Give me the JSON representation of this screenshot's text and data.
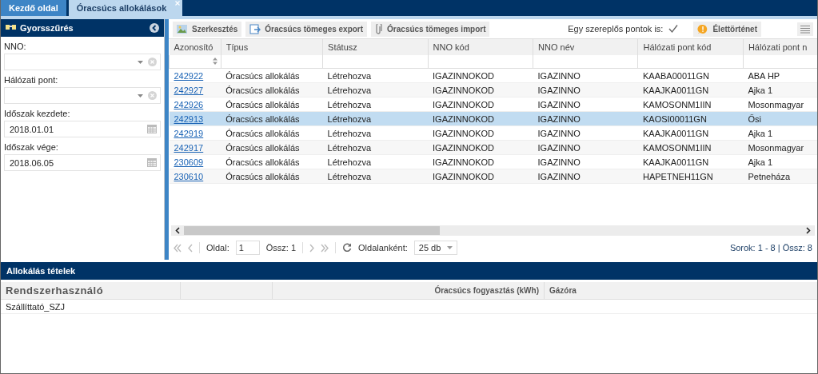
{
  "tabs": [
    {
      "label": "Kezdő oldal",
      "selected": false
    },
    {
      "label": "Óracsúcs allokálások",
      "selected": true,
      "closable": true
    }
  ],
  "filter": {
    "title": "Gyorsszűrés",
    "fields": [
      {
        "label": "NNO:",
        "kind": "combo"
      },
      {
        "label": "Hálózati pont:",
        "kind": "combo"
      },
      {
        "label": "Időszak kezdete:",
        "kind": "date",
        "value": "2018.01.01"
      },
      {
        "label": "Időszak vége:",
        "kind": "date",
        "value": "2018.06.05"
      }
    ]
  },
  "toolbar": {
    "buttons": [
      {
        "label": "Szerkesztés",
        "kind": "edit"
      },
      {
        "label": "Óracsúcs tömeges export",
        "kind": "export"
      },
      {
        "label": "Óracsúcs tömeges import",
        "kind": "import"
      }
    ],
    "checkbox": {
      "label": "Egy szereplős pontok is:",
      "checked": true
    },
    "history": "Élettörténet"
  },
  "table": {
    "columns": [
      "Azonosító",
      "Típus",
      "Státusz",
      "NNO kód",
      "NNO név",
      "Hálózati pont kód",
      "Hálózati pont n"
    ],
    "rows": [
      {
        "selected": false,
        "cells": [
          "242922",
          "Óracsúcs allokálás",
          "Létrehozva",
          "IGAZINNOKOD",
          "IGAZINNO",
          "KAABA00011GN",
          "ABA HP"
        ]
      },
      {
        "selected": false,
        "cells": [
          "242927",
          "Óracsúcs allokálás",
          "Létrehozva",
          "IGAZINNOKOD",
          "IGAZINNO",
          "KAAJKA0011GN",
          "Ajka 1"
        ]
      },
      {
        "selected": false,
        "cells": [
          "242926",
          "Óracsúcs allokálás",
          "Létrehozva",
          "IGAZINNOKOD",
          "IGAZINNO",
          "KAMOSONM1IIN",
          "Mosonmagyar"
        ]
      },
      {
        "selected": true,
        "cells": [
          "242913",
          "Óracsúcs allokálás",
          "Létrehozva",
          "IGAZINNOKOD",
          "IGAZINNO",
          "KAOSI00011GN",
          "Ősi"
        ]
      },
      {
        "selected": false,
        "cells": [
          "242919",
          "Óracsúcs allokálás",
          "Létrehozva",
          "IGAZINNOKOD",
          "IGAZINNO",
          "KAAJKA0011GN",
          "Ajka 1"
        ]
      },
      {
        "selected": false,
        "cells": [
          "242917",
          "Óracsúcs allokálás",
          "Létrehozva",
          "IGAZINNOKOD",
          "IGAZINNO",
          "KAMOSONM1IIN",
          "Mosonmagyar"
        ]
      },
      {
        "selected": false,
        "cells": [
          "230609",
          "Óracsúcs allokálás",
          "Létrehozva",
          "IGAZINNOKOD",
          "IGAZINNO",
          "KAAJKA0011GN",
          "Ajka 1"
        ]
      },
      {
        "selected": false,
        "cells": [
          "230610",
          "Óracsúcs allokálás",
          "Létrehozva",
          "IGAZINNOKOD",
          "IGAZINNO",
          "HAPETNEH11GN",
          "Petneháza"
        ]
      }
    ]
  },
  "pager": {
    "page_label": "Oldal:",
    "page": "1",
    "total": "Össz: 1",
    "per_page_label": "Oldalanként:",
    "per_page": "25 db",
    "summary": "Sorok: 1 - 8 | Össz: 8"
  },
  "details": {
    "title": "Allokálás tételek",
    "columns": [
      "Rendszerhasználó",
      "Óracsúcs fogyasztás (kWh)",
      "Gázóra"
    ],
    "rows": [
      "Szállíttató_SZJ"
    ]
  }
}
